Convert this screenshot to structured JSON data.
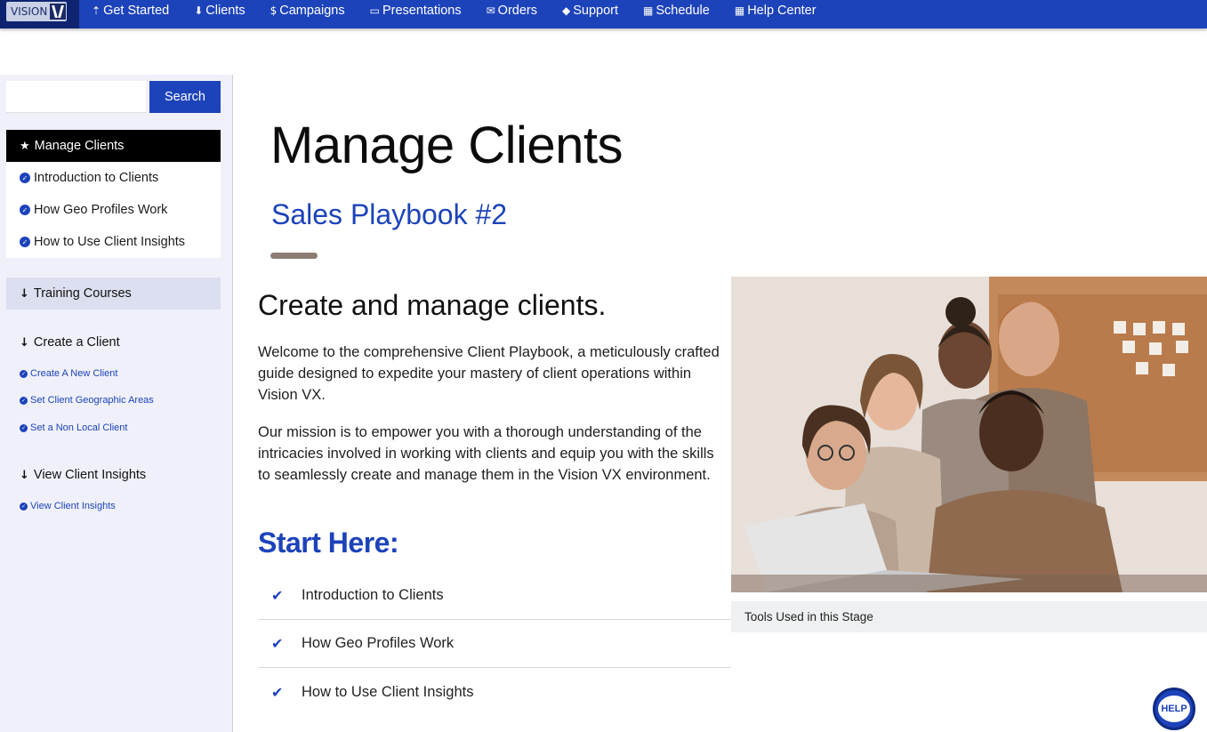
{
  "brand": {
    "logo_text": "VISION"
  },
  "nav": {
    "items": [
      {
        "label": "Get Started",
        "icon": "arrow-up-icon"
      },
      {
        "label": "Clients",
        "icon": "arrow-down-icon"
      },
      {
        "label": "Campaigns",
        "icon": "dollar-icon"
      },
      {
        "label": "Presentations",
        "icon": "monitor-icon"
      },
      {
        "label": "Orders",
        "icon": "envelope-icon"
      },
      {
        "label": "Support",
        "icon": "tag-icon"
      },
      {
        "label": "Schedule",
        "icon": "calendar-icon"
      },
      {
        "label": "Help Center",
        "icon": "calendar-icon"
      }
    ]
  },
  "sidebar": {
    "search_value": "",
    "search_button": "Search",
    "active_item": "Manage Clients",
    "links": [
      "Introduction to Clients",
      "How Geo Profiles Work",
      "How to Use Client Insights"
    ],
    "training": "Training Courses",
    "sections": [
      {
        "title": "Create a Client",
        "links": [
          "Create A New Client",
          "Set Client Geographic Areas",
          "Set a Non Local Client"
        ]
      },
      {
        "title": "View Client Insights",
        "links": [
          "View Client Insights"
        ]
      }
    ]
  },
  "main": {
    "title": "Manage Clients",
    "subtitle": "Sales Playbook #2",
    "heading": "Create and manage clients.",
    "paragraph1": "Welcome to the comprehensive Client Playbook, a meticulously crafted guide designed to expedite your mastery of client operations within Vision VX.",
    "paragraph2": "Our mission is to empower you with a thorough understanding of the intricacies involved in working with clients and equip you with the skills to seamlessly create and manage them in the Vision VX environment.",
    "start_heading": "Start Here:",
    "start_items": [
      "Introduction to Clients",
      "How Geo Profiles Work",
      "How to Use Client Insights"
    ],
    "image_caption": "Tools Used in this Stage"
  },
  "help_button": "HELP",
  "colors": {
    "brand_blue": "#1d43ba",
    "sidebar_bg": "#eff0f9",
    "accent_bar": "#8d7c72"
  }
}
